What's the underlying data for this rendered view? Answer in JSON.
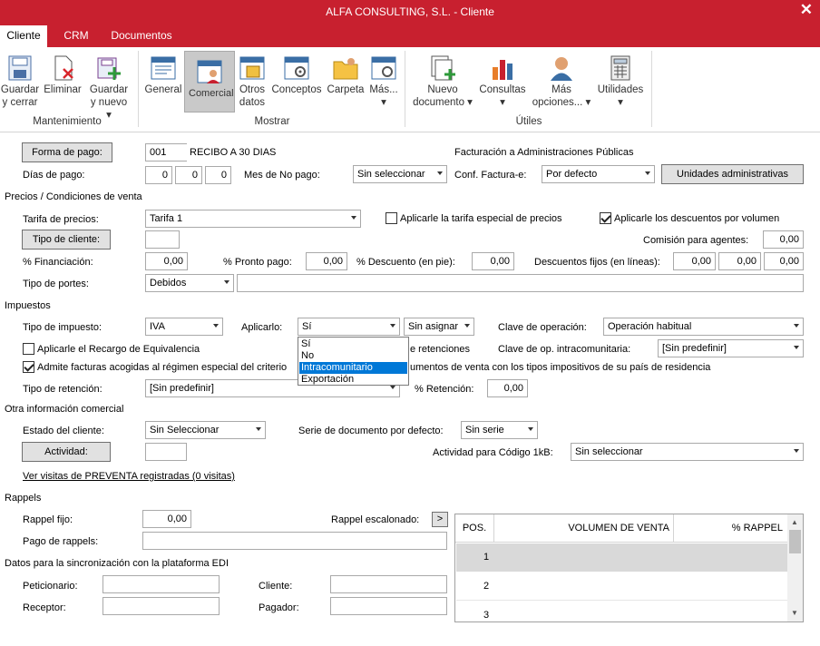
{
  "window": {
    "title": "ALFA CONSULTING, S.L. - Cliente",
    "close_glyph": "✕"
  },
  "tabs": [
    {
      "label": "Cliente"
    },
    {
      "label": "CRM"
    },
    {
      "label": "Documentos"
    }
  ],
  "ribbon": {
    "buttons": [
      {
        "label": "Guardar y cerrar",
        "l1": "Guardar",
        "l2": "y cerrar",
        "icon": "save-close-icon"
      },
      {
        "label": "Eliminar",
        "l1": "Eliminar",
        "l2": "",
        "icon": "delete-icon"
      },
      {
        "label": "Guardar y nuevo",
        "l1": "Guardar",
        "l2": "y nuevo ▾",
        "icon": "save-new-icon"
      },
      {
        "label": "General",
        "l1": "General",
        "l2": "",
        "icon": "general-icon"
      },
      {
        "label": "Comercial",
        "l1": "Comercial",
        "l2": "",
        "icon": "comercial-icon"
      },
      {
        "label": "Otros datos",
        "l1": "Otros",
        "l2": "datos",
        "icon": "otros-datos-icon"
      },
      {
        "label": "Conceptos",
        "l1": "Conceptos",
        "l2": "",
        "icon": "conceptos-icon"
      },
      {
        "label": "Carpeta",
        "l1": "Carpeta",
        "l2": "",
        "icon": "folder-icon"
      },
      {
        "label": "Más...",
        "l1": "Más...",
        "l2": "▾",
        "icon": "more-icon"
      },
      {
        "label": "Nuevo documento",
        "l1": "Nuevo",
        "l2": "documento ▾",
        "icon": "new-document-icon"
      },
      {
        "label": "Consultas",
        "l1": "Consultas",
        "l2": "▾",
        "icon": "chart-icon"
      },
      {
        "label": "Más opciones...",
        "l1": "Más",
        "l2": "opciones... ▾",
        "icon": "user-options-icon"
      },
      {
        "label": "Utilidades",
        "l1": "Utilidades",
        "l2": "▾",
        "icon": "calculator-icon"
      }
    ],
    "groups": [
      {
        "label": "Mantenimiento"
      },
      {
        "label": "Mostrar"
      },
      {
        "label": "Útiles"
      }
    ]
  },
  "form": {
    "forma_pago_btn": "Forma de pago:",
    "forma_pago_code": "001",
    "forma_pago_desc": "RECIBO A 30 DIAS",
    "facturacion_title": "Facturación a Administraciones Públicas",
    "dias_pago_label": "Días de pago:",
    "dias_pago": [
      "0",
      "0",
      "0"
    ],
    "mes_no_pago_label": "Mes de No pago:",
    "mes_no_pago": "Sin seleccionar",
    "conf_factura_label": "Conf. Factura-e:",
    "conf_factura": "Por defecto",
    "unidades_btn": "Unidades administrativas",
    "precios_section": "Precios / Condiciones de venta",
    "tarifa_label": "Tarifa de precios:",
    "tarifa": "Tarifa 1",
    "tarifa_especial_label": "Aplicarle la tarifa especial de precios",
    "descuentos_volumen_label": "Aplicarle los descuentos por volumen",
    "tipo_cliente_btn": "Tipo de cliente:",
    "tipo_cliente": "",
    "comision_label": "Comisión para agentes:",
    "comision": "0,00",
    "financiacion_label": "% Financiación:",
    "financiacion": "0,00",
    "pronto_pago_label": "% Pronto pago:",
    "pronto_pago": "0,00",
    "descuento_pie_label": "% Descuento (en pie):",
    "descuento_pie": "0,00",
    "descuentos_fijos_label": "Descuentos fijos (en líneas):",
    "descuentos_fijos": [
      "0,00",
      "0,00",
      "0,00"
    ],
    "tipo_portes_label": "Tipo de portes:",
    "tipo_portes": "Debidos",
    "tipo_portes_extra": "",
    "impuestos_section": "Impuestos",
    "tipo_impuesto_label": "Tipo de impuesto:",
    "tipo_impuesto": "IVA",
    "aplicarlo_label": "Aplicarlo:",
    "aplicarlo": "Sí",
    "sin_asignar": "Sin asignar",
    "clave_operacion_label": "Clave de operación:",
    "clave_operacion": "Operación habitual",
    "recargo_label": "Aplicarle el Recargo de Equivalencia",
    "retenciones_partial": "e retenciones",
    "clave_intracom_label": "Clave de op. intracomunitaria:",
    "clave_intracom": "[Sin predefinir]",
    "admite_label_a": "Admite facturas acogidas al régimen especial del criterio",
    "admite_label_b": "umentos de venta con los tipos impositivos de su país de residencia",
    "tipo_retencion_label": "Tipo de retención:",
    "tipo_retencion": "[Sin predefinir]",
    "pct_retencion_label": "% Retención:",
    "pct_retencion": "0,00",
    "otra_info_section": "Otra información comercial",
    "estado_label": "Estado del cliente:",
    "estado": "Sin Seleccionar",
    "serie_label": "Serie de documento por defecto:",
    "serie": "Sin serie",
    "actividad_btn": "Actividad:",
    "actividad": "",
    "actividad_1kb_label": "Actividad para Código 1kB:",
    "actividad_1kb": "Sin seleccionar",
    "visitas_link": "Ver visitas de PREVENTA registradas (0 visitas)",
    "rappels_section": "Rappels",
    "rappel_fijo_label": "Rappel fijo:",
    "rappel_fijo": "0,00",
    "rappel_escalonado_label": "Rappel escalonado:",
    "rappel_escalonado_btn": ">",
    "pago_rappels_label": "Pago de rappels:",
    "pago_rappels": "",
    "edi_section": "Datos para la sincronización con la plataforma EDI",
    "peticionario_label": "Peticionario:",
    "cliente_label": "Cliente:",
    "receptor_label": "Receptor:",
    "pagador_label": "Pagador:"
  },
  "aplicarlo_dropdown": {
    "options": [
      "Sí",
      "No",
      "Intracomunitario",
      "Exportación"
    ],
    "highlighted": "Intracomunitario"
  },
  "rappel_grid": {
    "headers": [
      "POS.",
      "VOLUMEN DE VENTA",
      "% RAPPEL"
    ],
    "rows": [
      {
        "pos": "1"
      },
      {
        "pos": "2"
      },
      {
        "pos": "3"
      }
    ]
  },
  "colors": {
    "accent": "#c8202f",
    "highlight": "#0078d7",
    "selected_row": "#d9d9d9"
  }
}
